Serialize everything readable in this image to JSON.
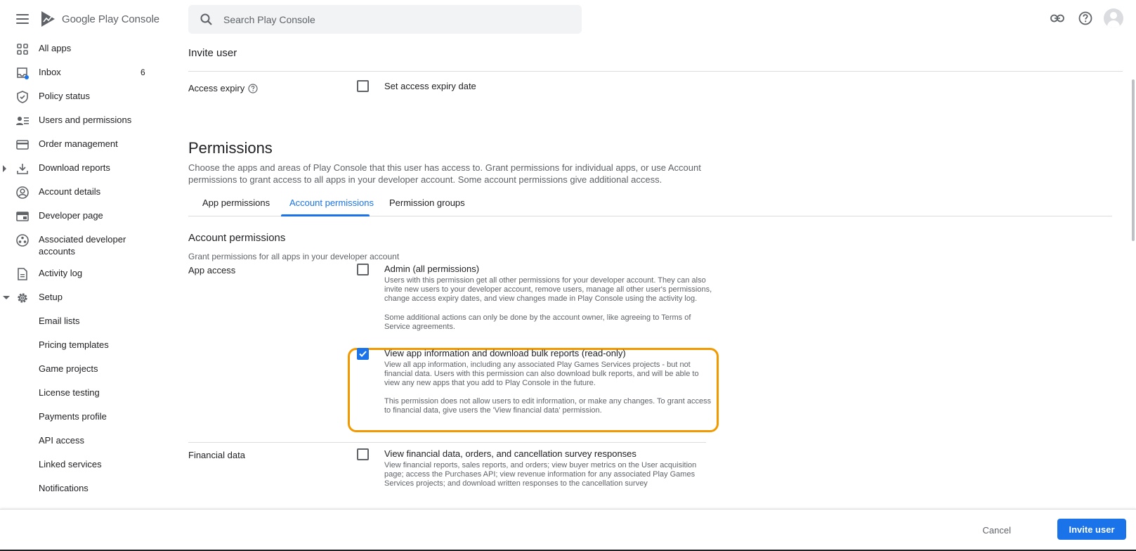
{
  "app": {
    "brand_google": "Google Play",
    "brand_console": "Console"
  },
  "search": {
    "placeholder": "Search Play Console"
  },
  "sidebar": {
    "items": [
      {
        "label": "All apps",
        "icon": "grid-icon"
      },
      {
        "label": "Inbox",
        "icon": "inbox-icon",
        "count": "6"
      },
      {
        "label": "Policy status",
        "icon": "shield-icon"
      },
      {
        "label": "Users and permissions",
        "icon": "users-icon"
      },
      {
        "label": "Order management",
        "icon": "credit-card-icon"
      },
      {
        "label": "Download reports",
        "icon": "download-icon"
      },
      {
        "label": "Account details",
        "icon": "account-icon"
      },
      {
        "label": "Developer page",
        "icon": "developer-page-icon"
      },
      {
        "label": "Associated developer accounts",
        "icon": "associated-accounts-icon"
      },
      {
        "label": "Activity log",
        "icon": "document-icon"
      },
      {
        "label": "Setup",
        "icon": "gear-icon"
      },
      {
        "label": "Email lists"
      },
      {
        "label": "Pricing templates"
      },
      {
        "label": "Game projects"
      },
      {
        "label": "License testing"
      },
      {
        "label": "Payments profile"
      },
      {
        "label": "API access"
      },
      {
        "label": "Linked services"
      },
      {
        "label": "Notifications"
      }
    ]
  },
  "main": {
    "invite_title": "Invite user",
    "access_expiry_label": "Access expiry",
    "access_expiry_checkbox": "Set access expiry date",
    "permissions_title": "Permissions",
    "permissions_desc": "Choose the apps and areas of Play Console that this user has access to. Grant permissions for individual apps, or use Account permissions to grant access to all apps in your developer account. Some account permissions give additional access.",
    "tabs": [
      "App permissions",
      "Account permissions",
      "Permission groups"
    ],
    "active_tab": "Account permissions",
    "account_permissions_title": "Account permissions",
    "account_permissions_sub": "Grant permissions for all apps in your developer account",
    "app_access_label": "App access",
    "admin": {
      "label": "Admin (all permissions)",
      "checked": false,
      "desc1": "Users with this permission get all other permissions for your developer account. They can also invite new users to your developer account, remove users, manage all other user's permissions, change access expiry dates, and view changes made in Play Console using the activity log.",
      "desc2": "Some additional actions can only be done by the account owner, like agreeing to Terms of Service agreements."
    },
    "view_app_info": {
      "label": "View app information and download bulk reports (read-only)",
      "checked": true,
      "desc1": "View all app information, including any associated Play Games Services projects - but not financial data. Users with this permission can also download bulk reports, and will be able to view any new apps that you add to Play Console in the future.",
      "desc2": "This permission does not allow users to edit information, or make any changes. To grant access to financial data, give users the 'View financial data' permission."
    },
    "financial_data_label": "Financial data",
    "financial": {
      "label": "View financial data, orders, and cancellation survey responses",
      "checked": false,
      "desc1": "View financial reports, sales reports, and orders; view buyer metrics on the User acquisition page; access the Purchases API; view revenue information for any associated Play Games Services projects; and download written responses to the cancellation survey"
    }
  },
  "footer": {
    "cancel_label": "Cancel",
    "invite_label": "Invite user"
  },
  "colors": {
    "accent": "#1a73e8",
    "highlight": "#f29900",
    "text_primary": "#202124",
    "text_secondary": "#5f6368"
  }
}
